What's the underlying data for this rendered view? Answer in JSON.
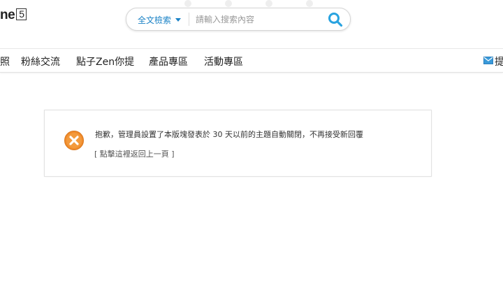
{
  "header": {
    "logo_text": "ne",
    "logo_box": "5",
    "search": {
      "scope_label": "全文檢索",
      "placeholder": "請輸入搜索內容"
    }
  },
  "nav": {
    "items": [
      {
        "label": "照"
      },
      {
        "label": "粉絲交流"
      },
      {
        "label": "點子Zen你提"
      },
      {
        "label": "產品專區"
      },
      {
        "label": "活動專區"
      }
    ],
    "right_label": "提"
  },
  "alert": {
    "message": "抱歉，管理員設置了本版塊發表於 30 天以前的主題自動關閉，不再接受新回覆",
    "back_link": "[ 點擊這裡返回上一頁 ]"
  },
  "colors": {
    "accent": "#1a82c6",
    "error_icon": "#f08c2c"
  }
}
